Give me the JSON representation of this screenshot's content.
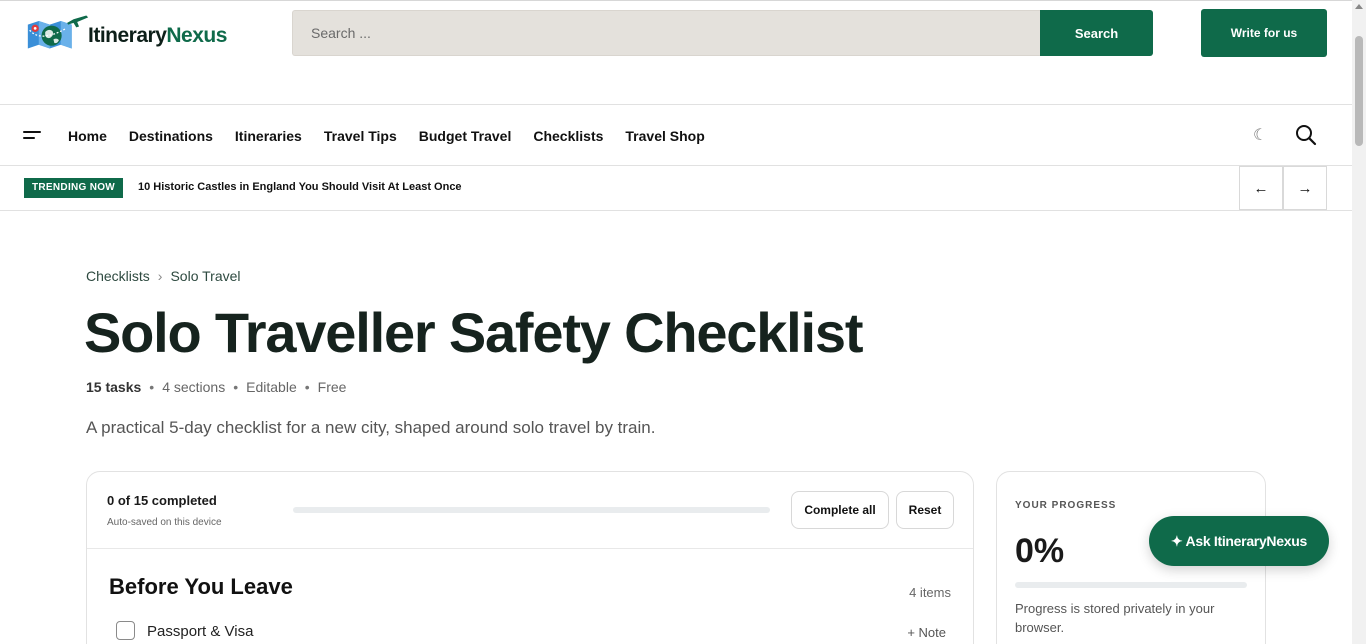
{
  "brand": {
    "name_part1": "Itinerary",
    "name_part2": "Nexus",
    "accent": "#0f6a4a"
  },
  "header": {
    "search_placeholder": "Search ...",
    "search_button": "Search",
    "write_button": "Write for us"
  },
  "nav": {
    "menu_icon": "hamburger-icon",
    "items": [
      "Home",
      "Destinations",
      "Itineraries",
      "Travel Tips",
      "Budget Travel",
      "Checklists",
      "Travel Shop"
    ],
    "theme_icon": "☾",
    "search_icon": "search-icon"
  },
  "trending": {
    "badge": "TRENDING NOW",
    "headline": "10 Historic Castles in England You Should Visit At Least Once",
    "prev": "←",
    "next": "→"
  },
  "breadcrumb": {
    "items": [
      "Checklists",
      "Solo Travel"
    ],
    "separator": "›"
  },
  "article": {
    "title": "Solo Traveller Safety Checklist",
    "meta": {
      "tasks": "15 tasks",
      "sections": "4 sections",
      "editable": "Editable",
      "price": "Free",
      "dot": "•"
    },
    "description": "A practical 5-day checklist for a new city, shaped around solo travel by train."
  },
  "checklist": {
    "completed_text": "0 of 15 completed",
    "autosave_text": "Auto-saved on this device",
    "progress": 0,
    "complete_all": "Complete all",
    "reset": "Reset",
    "sections": [
      {
        "title": "Before You Leave",
        "count": "4 items",
        "tasks": [
          {
            "label": "Passport & Visa",
            "note": "+ Note",
            "checked": false
          }
        ]
      }
    ]
  },
  "progress_card": {
    "label": "YOUR PROGRESS",
    "percent": "0%",
    "value": 0,
    "note": "Progress is stored privately in your browser."
  },
  "assistant": {
    "label": "✦ Ask ItineraryNexus"
  }
}
